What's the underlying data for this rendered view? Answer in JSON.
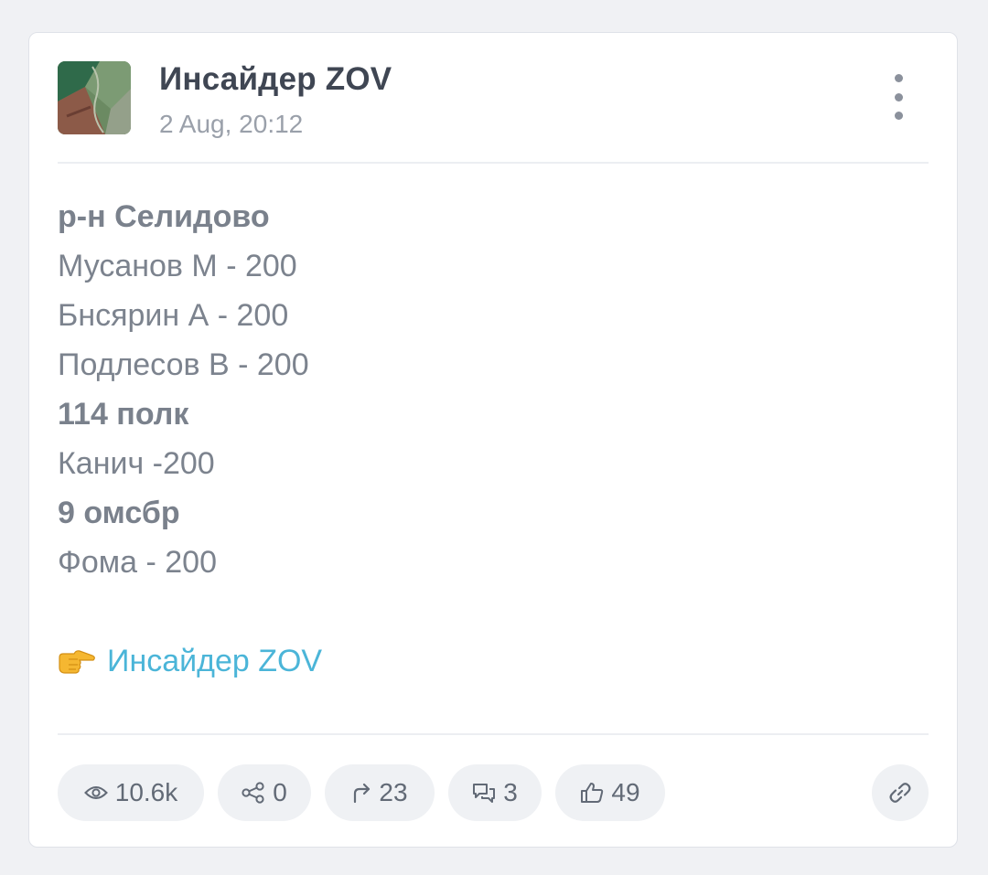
{
  "post": {
    "channel_name": "Инсайдер ZOV",
    "date": "2 Aug, 20:12",
    "lines": [
      {
        "text": "р-н Селидово",
        "bold": true
      },
      {
        "text": "Мусанов М - 200",
        "bold": false
      },
      {
        "text": "Бнсярин А - 200",
        "bold": false
      },
      {
        "text": "Подлесов В - 200",
        "bold": false
      },
      {
        "text": "114 полк",
        "bold": true
      },
      {
        "text": "Канич -200",
        "bold": false
      },
      {
        "text": "9 омсбр",
        "bold": true
      },
      {
        "text": "Фома - 200",
        "bold": false
      }
    ],
    "signature_link": "Инсайдер ZOV",
    "signature_emoji": "pointing-right-hand"
  },
  "stats": {
    "views": "10.6k",
    "shares": "0",
    "forwards": "23",
    "comments": "3",
    "reactions": "49"
  },
  "icons": {
    "views": "eye-icon",
    "shares": "share-icon",
    "forwards": "forward-arrow-icon",
    "comments": "comments-icon",
    "reactions": "thumbs-up-icon",
    "copy_link": "link-icon",
    "menu": "more-vertical-icon"
  },
  "colors": {
    "link": "#4bb5d8",
    "body_text": "#7c838e",
    "title": "#3f4653",
    "pill_bg": "#eff1f4"
  }
}
